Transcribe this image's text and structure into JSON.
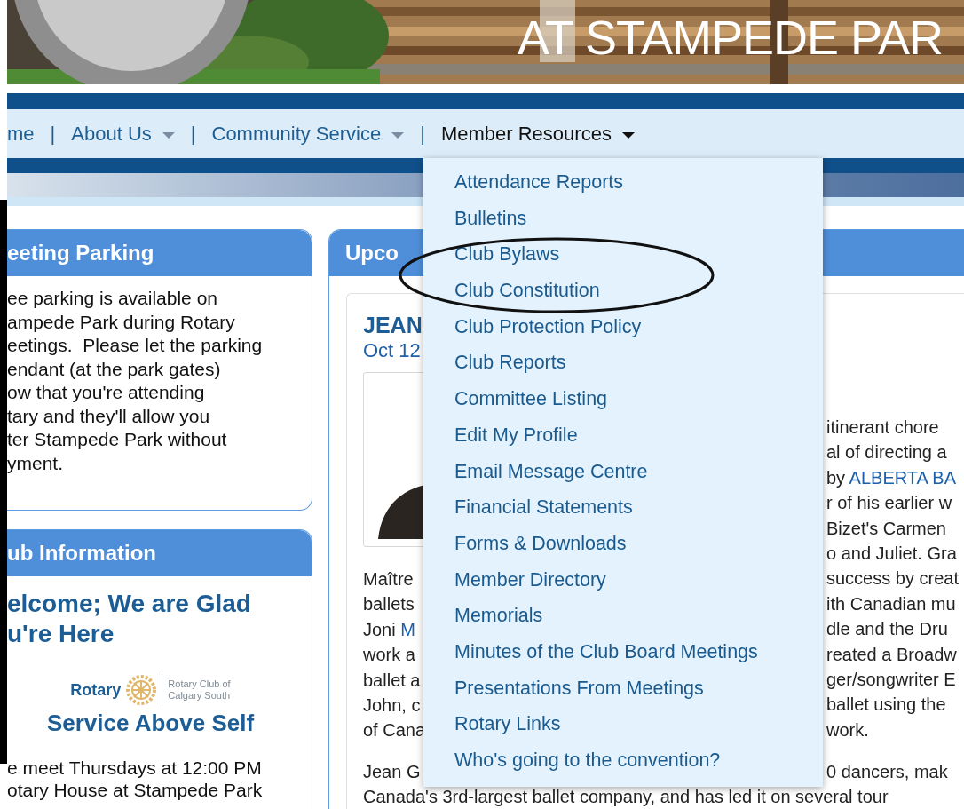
{
  "banner": {
    "title": "AT STAMPEDE PAR"
  },
  "nav": [
    {
      "kind": "link",
      "label": "me",
      "dropdown": false,
      "selected": false
    },
    {
      "kind": "separator",
      "label": "|"
    },
    {
      "kind": "link",
      "label": "About Us",
      "dropdown": true,
      "selected": false
    },
    {
      "kind": "separator",
      "label": "|"
    },
    {
      "kind": "link",
      "label": "Community Service",
      "dropdown": true,
      "selected": false
    },
    {
      "kind": "separator",
      "label": "|"
    },
    {
      "kind": "link",
      "label": "Member Resources",
      "dropdown": true,
      "selected": true
    }
  ],
  "menu": {
    "items": [
      "Attendance Reports",
      "Bulletins",
      "Club Bylaws",
      "Club Constitution",
      "Club Protection Policy",
      "Club Reports",
      "Committee Listing",
      "Edit My Profile",
      "Email Message Centre",
      "Financial Statements",
      "Forms & Downloads",
      "Member Directory",
      "Memorials",
      "Minutes of the Club Board Meetings",
      "Presentations From Meetings",
      "Rotary Links",
      "Who's going to the convention?"
    ]
  },
  "sidebar": {
    "parking": {
      "title": "eeting Parking",
      "lines": [
        "ee parking is available on",
        "ampede Park during Rotary",
        "eetings.  Please let the parking",
        "endant (at the park gates)",
        "ow that you're attending",
        "tary and they'll allow you",
        "ter Stampede Park without",
        "yment."
      ]
    },
    "info": {
      "title": "ub Information",
      "heading_lines": [
        "elcome; We are Glad",
        "u're Here"
      ],
      "wordmark": "Rotary",
      "club_lines": [
        "Rotary Club of",
        "Calgary South"
      ],
      "motto": "Service Above Self",
      "lines": [
        "e meet Thursdays at 12:00 PM",
        "otary House at Stampede Park"
      ]
    }
  },
  "main": {
    "title": "Upco",
    "event": {
      "title": "JEAN",
      "date": "Oct 12"
    },
    "rows": [
      {
        "right": "itinerant chore"
      },
      {
        "right": "al of directing a"
      },
      {
        "right": "by ",
        "right_link": "ALBERTA BA"
      },
      {
        "right": "r of his earlier w"
      },
      {
        "right": "Bizet's Carmen"
      },
      {
        "right": "o and Juliet. Gra"
      },
      {
        "left": "Maître",
        "right": "success by creat"
      },
      {
        "left": "ballets",
        "right": "ith Canadian mu"
      },
      {
        "left": "Joni ",
        "left_link": "M",
        "right": "dle and the Dru"
      },
      {
        "left": "work a",
        "right": "reated a Broadw"
      },
      {
        "left": "ballet a",
        "right": "ger/songwriter E"
      },
      {
        "left": "John, c",
        "right": "ballet using the"
      },
      {
        "left": "of Cana",
        "right": "work."
      }
    ],
    "rows2": [
      {
        "left": "Jean G",
        "right": "0 dancers, mak"
      }
    ],
    "last_line": "Canada's 3rd-largest ballet company, and has led it on several tour"
  }
}
